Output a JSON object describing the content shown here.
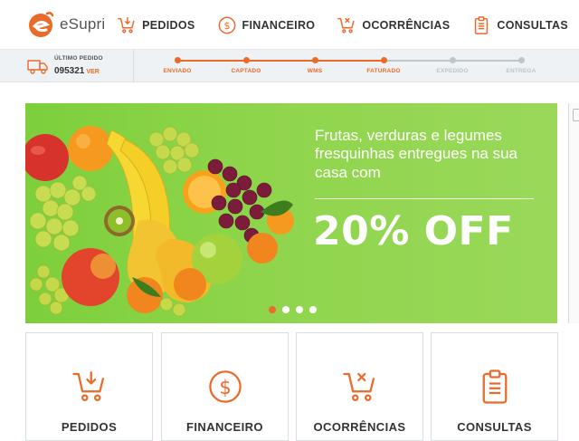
{
  "app": {
    "logo_text": "eSupri"
  },
  "nav": {
    "items": [
      {
        "label": "PEDIDOS",
        "icon": "cart-download-icon"
      },
      {
        "label": "FINANCEIRO",
        "icon": "dollar-circle-icon"
      },
      {
        "label": "OCORRÊNCIAS",
        "icon": "cart-x-icon"
      },
      {
        "label": "CONSULTAS",
        "icon": "clipboard-icon"
      }
    ]
  },
  "status": {
    "last_order_label": "ÚLTIMO PEDIDO",
    "last_order_number": "095321",
    "view_label": "VER",
    "steps": [
      {
        "label": "ENVIADO",
        "done": true
      },
      {
        "label": "CAPTADO",
        "done": true
      },
      {
        "label": "WMS",
        "done": true
      },
      {
        "label": "FATURADO",
        "done": true
      },
      {
        "label": "EXPEDIDO",
        "done": false
      },
      {
        "label": "ENTREGA",
        "done": false
      }
    ]
  },
  "banner": {
    "headline": "Frutas, verduras e legumes fresquinhas entregues na sua casa com",
    "offer": "20% OFF",
    "slide_count": 4,
    "active_slide": 1
  },
  "cards": [
    {
      "label": "PEDIDOS",
      "icon": "cart-download-icon"
    },
    {
      "label": "FINANCEIRO",
      "icon": "dollar-circle-icon"
    },
    {
      "label": "OCORRÊNCIAS",
      "icon": "cart-x-icon"
    },
    {
      "label": "CONSULTAS",
      "icon": "clipboard-icon"
    }
  ],
  "colors": {
    "accent": "#ea6a2a",
    "banner_green": "#8fd54c",
    "pending": "#bcc6cb",
    "text": "#333333"
  }
}
